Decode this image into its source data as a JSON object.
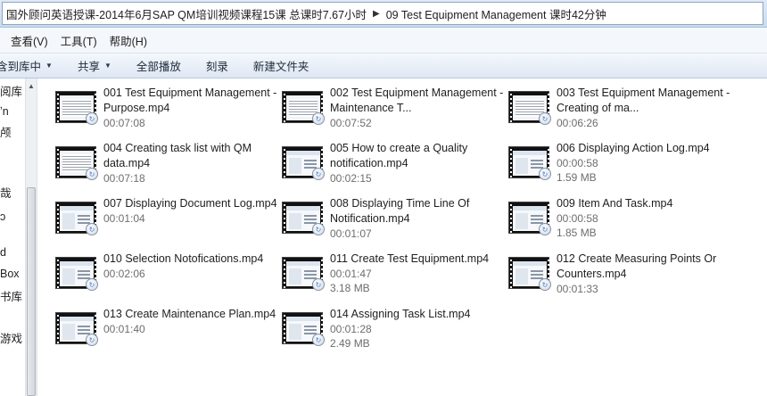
{
  "address": {
    "crumbs": [
      "国外顾问英语授课-2014年6月SAP QM培训视频课程15课  总课时7.67小时",
      "09 Test Equipment Management 课时42分钟"
    ],
    "separator": "▶"
  },
  "menu": [
    "查看(V)",
    "工具(T)",
    "帮助(H)"
  ],
  "commands": [
    {
      "label": "含到库中",
      "dropdown": true
    },
    {
      "label": "共享",
      "dropdown": true
    },
    {
      "label": "全部播放",
      "dropdown": false
    },
    {
      "label": "刻录",
      "dropdown": false
    },
    {
      "label": "新建文件夹",
      "dropdown": false
    }
  ],
  "nav_fragments": [
    "阅库",
    "ʼn",
    "颅",
    "哉",
    "ɔ",
    "d",
    "Box",
    "书库",
    "游戏"
  ],
  "files": [
    {
      "name": "001 Test Equipment Management - Purpose.mp4",
      "duration": "00:07:08",
      "size": "",
      "thumb": "doc"
    },
    {
      "name": "002 Test Equipment Management - Maintenance T...",
      "duration": "00:07:52",
      "size": "",
      "thumb": "doc"
    },
    {
      "name": "003 Test Equipment Management - Creating of ma...",
      "duration": "00:06:26",
      "size": "",
      "thumb": "doc"
    },
    {
      "name": "004 Creating task list with QM data.mp4",
      "duration": "00:07:18",
      "size": "",
      "thumb": "doc"
    },
    {
      "name": "005 How to create a Quality notification.mp4",
      "duration": "00:02:15",
      "size": "",
      "thumb": "app"
    },
    {
      "name": "006 Displaying Action Log.mp4",
      "duration": "00:00:58",
      "size": "1.59 MB",
      "thumb": "app"
    },
    {
      "name": "007 Displaying Document Log.mp4",
      "duration": "00:01:04",
      "size": "",
      "thumb": "app"
    },
    {
      "name": "008 Displaying Time Line Of Notification.mp4",
      "duration": "00:01:07",
      "size": "",
      "thumb": "app"
    },
    {
      "name": "009 Item And Task.mp4",
      "duration": "00:00:58",
      "size": "1.85 MB",
      "thumb": "app"
    },
    {
      "name": "010 Selection Notofications.mp4",
      "duration": "00:02:06",
      "size": "",
      "thumb": "app"
    },
    {
      "name": "011 Create Test Equipment.mp4",
      "duration": "00:01:47",
      "size": "3.18 MB",
      "thumb": "app"
    },
    {
      "name": "012 Create Measuring Points Or Counters.mp4",
      "duration": "00:01:33",
      "size": "",
      "thumb": "app"
    },
    {
      "name": "013 Create Maintenance Plan.mp4",
      "duration": "00:01:40",
      "size": "",
      "thumb": "app"
    },
    {
      "name": "014 Assigning Task List.mp4",
      "duration": "00:01:28",
      "size": "2.49 MB",
      "thumb": "app"
    }
  ]
}
